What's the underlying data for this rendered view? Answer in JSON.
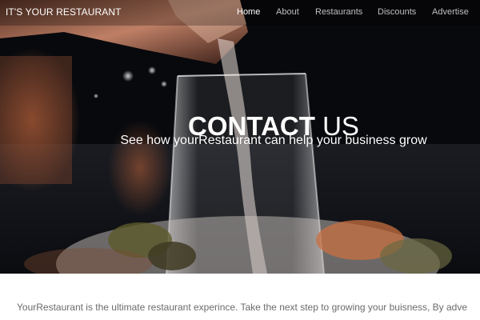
{
  "navbar": {
    "brand": "IT'S YOUR RESTAURANT",
    "links": [
      {
        "label": "Home",
        "active": true
      },
      {
        "label": "About",
        "active": false
      },
      {
        "label": "Restaurants",
        "active": false
      },
      {
        "label": "Discounts",
        "active": false
      },
      {
        "label": "Advertise",
        "active": false
      }
    ]
  },
  "hero": {
    "title_bold": "CONTACT",
    "title_light": "US",
    "subtitle": "See how yourRestaurant can help your business grow"
  },
  "content": {
    "intro": "YourRestaurant is the ultimate restaurant experince. Take the next step to growing your buisness, By adve"
  }
}
